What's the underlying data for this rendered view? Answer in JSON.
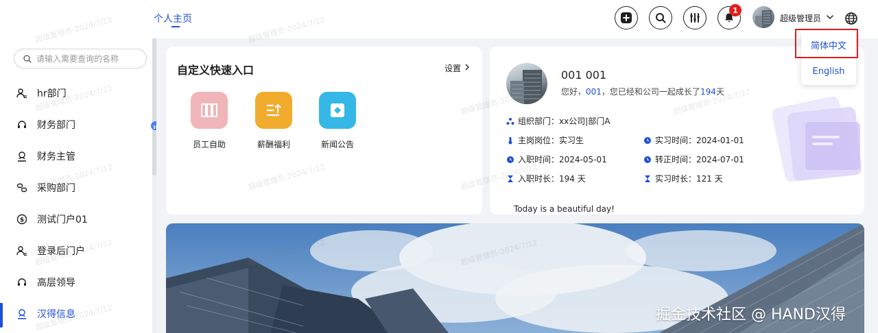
{
  "header": {
    "page_tab": "个人主页",
    "notification_count": "1",
    "user_name": "超级管理员",
    "icons": [
      "add-icon",
      "search-icon",
      "settings-sliders-icon",
      "bell-icon",
      "chevron-down-icon",
      "globe-icon"
    ]
  },
  "sidebar": {
    "search_placeholder": "请输入需要查询的名称",
    "items": [
      {
        "label": "hr部门",
        "icon": "user-group-icon"
      },
      {
        "label": "财务部门",
        "icon": "headset-icon"
      },
      {
        "label": "财务主管",
        "icon": "user-badge-icon"
      },
      {
        "label": "采购部门",
        "icon": "link-icon"
      },
      {
        "label": "测试门户01",
        "icon": "dollar-icon"
      },
      {
        "label": "登录后门户",
        "icon": "user-group-icon"
      },
      {
        "label": "高层领导",
        "icon": "headset-icon"
      },
      {
        "label": "汉得信息",
        "icon": "user-badge-icon",
        "active": true
      }
    ]
  },
  "quick_access": {
    "title": "自定义快速入口",
    "settings_label": "设置",
    "items": [
      {
        "label": "员工自助",
        "color": "#f0b5b8"
      },
      {
        "label": "薪酬福利",
        "color": "#f1ac2e"
      },
      {
        "label": "新闻公告",
        "color": "#35b8e8"
      }
    ]
  },
  "profile": {
    "name": "001 001",
    "greeting_prefix": "您好，",
    "greeting_user": "001",
    "greeting_mid": "，您已经和公司一起成长了",
    "greeting_days": "194",
    "greeting_suffix": "天",
    "department": "组织部门：xx公司|部门A",
    "position": "主岗岗位：实习生",
    "intern_time": "实习时间：2024-01-01",
    "join_time": "入职时间：2024-05-01",
    "regular_time": "转正时间：2024-07-01",
    "tenure": "入职时长：194 天",
    "intern_duration": "实习时长：121 天",
    "motto": "Today is a beautiful day!"
  },
  "language_menu": {
    "options": [
      "简体中文",
      "English"
    ],
    "selected": "简体中文"
  },
  "watermark": "超级管理员-2024/7/12",
  "credit": "掘金技术社区 @ HAND汉得",
  "colors": {
    "accent": "#1d4fd8",
    "badge": "#e41c1c",
    "highlight_box": "#e01b1b"
  }
}
